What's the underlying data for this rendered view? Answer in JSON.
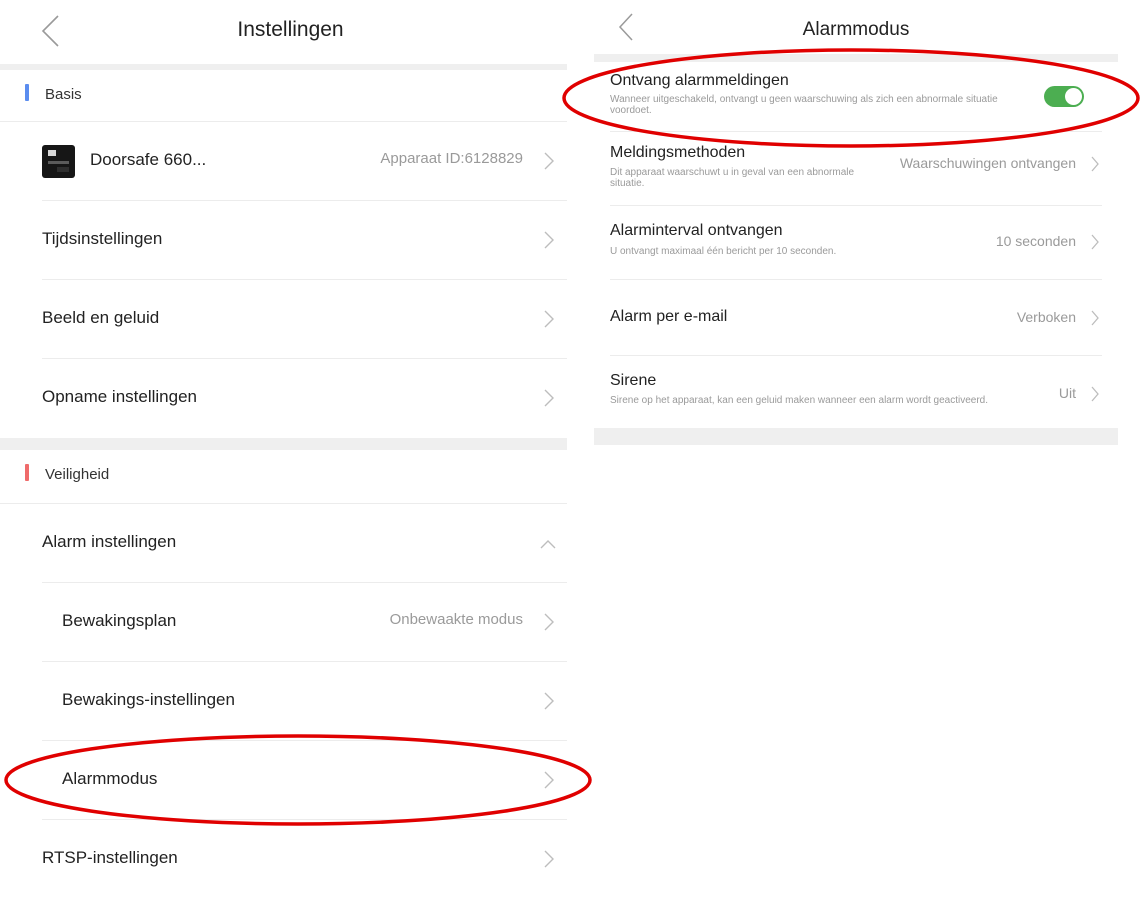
{
  "left": {
    "title": "Instellingen",
    "sections": {
      "basis": {
        "label": "Basis",
        "color": "#5b8def"
      },
      "veiligheid": {
        "label": "Veiligheid",
        "color": "#ef6b6b"
      }
    },
    "device": {
      "name": "Doorsafe 660...",
      "id_text": "Apparaat ID:6128829"
    },
    "items": {
      "tijd": "Tijdsinstellingen",
      "beeld": "Beeld en geluid",
      "opname": "Opname instellingen",
      "alarm_instellingen": "Alarm instellingen",
      "bewakingsplan": "Bewakingsplan",
      "bewakingsplan_value": "Onbewaakte modus",
      "bewakings_instellingen": "Bewakings-instellingen",
      "alarmmodus": "Alarmmodus",
      "rtsp": "RTSP-instellingen"
    }
  },
  "right": {
    "title": "Alarmmodus",
    "receive": {
      "title": "Ontvang alarmmeldingen",
      "desc": "Wanneer uitgeschakeld, ontvangt u geen waarschuwing als zich een abnormale situatie voordoet.",
      "enabled": true
    },
    "methods": {
      "title": "Meldingsmethoden",
      "desc": "Dit apparaat waarschuwt u in geval van een abnormale situatie.",
      "value": "Waarschuwingen ontvangen"
    },
    "interval": {
      "title": "Alarminterval ontvangen",
      "desc": "U ontvangt maximaal één bericht per 10 seconden.",
      "value": "10 seconden"
    },
    "email": {
      "title": "Alarm per e-mail",
      "value": "Verboken"
    },
    "siren": {
      "title": "Sirene",
      "desc": "Sirene op het apparaat, kan een geluid maken wanneer een alarm wordt geactiveerd.",
      "value": "Uit"
    }
  },
  "colors": {
    "toggle_on": "#4cae51",
    "annotation": "#e00000",
    "divider": "#efefef"
  }
}
